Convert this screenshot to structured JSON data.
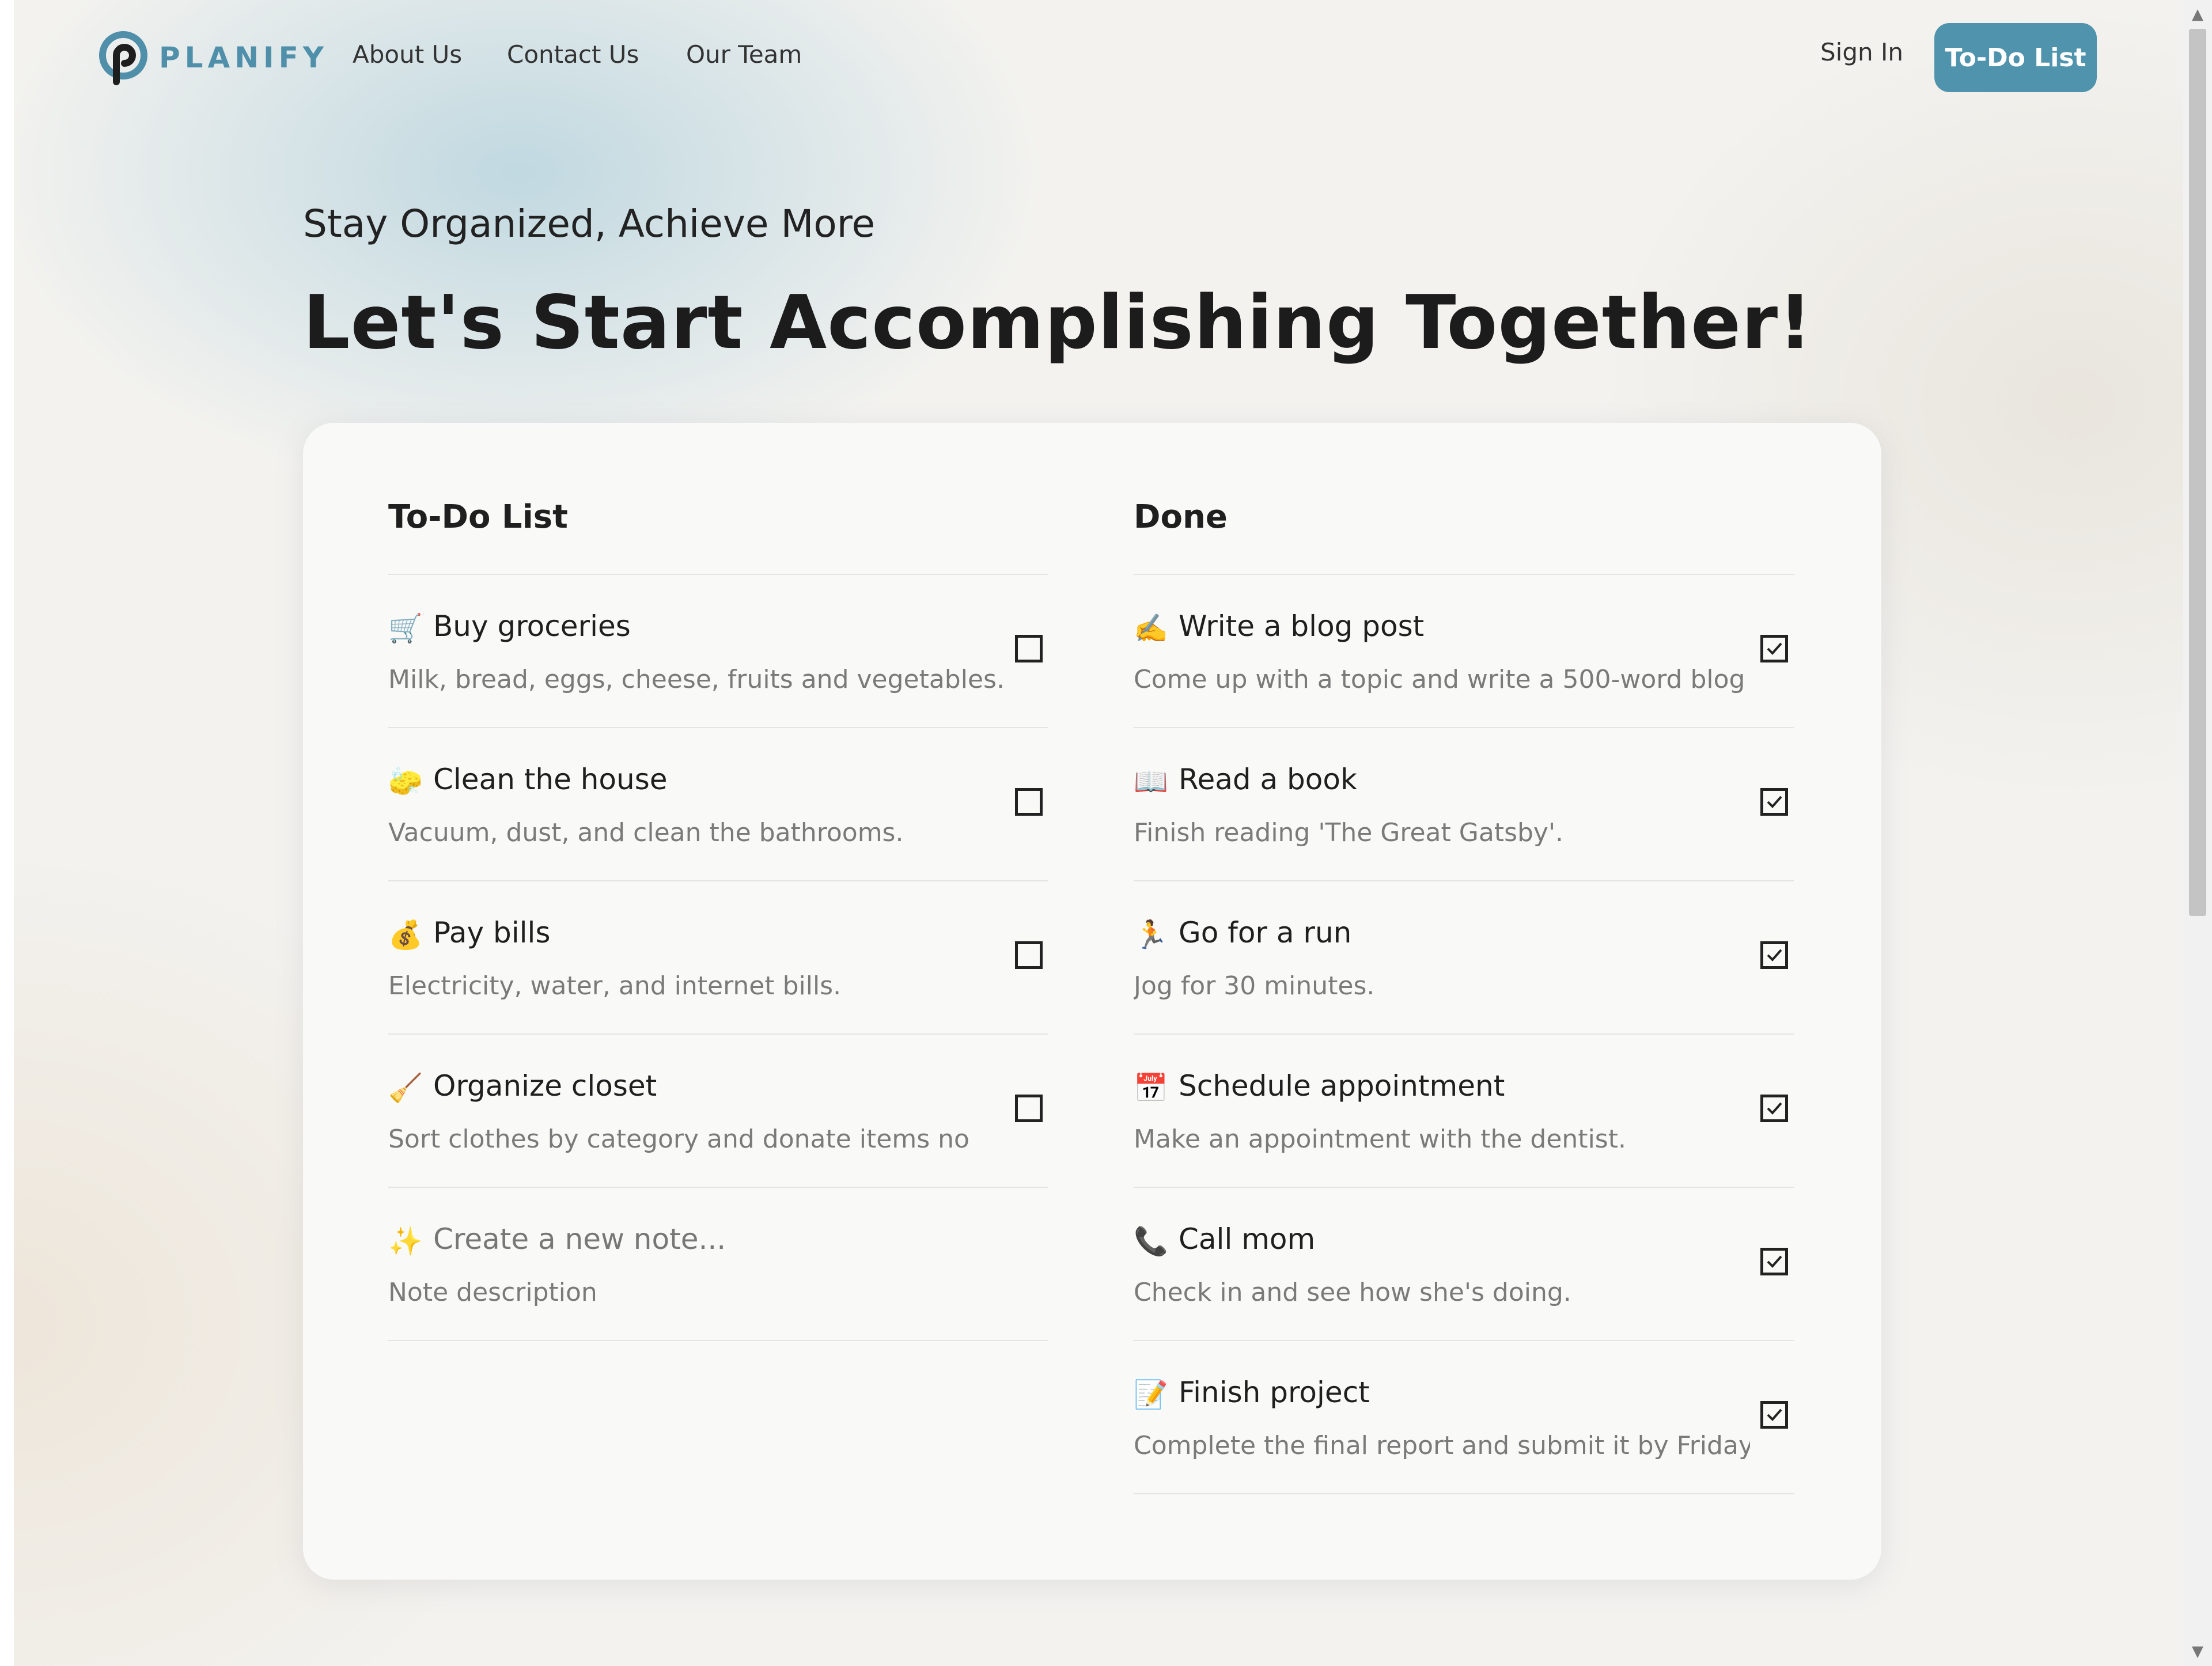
{
  "nav": {
    "brand": "PLANIFY",
    "links": [
      "About Us",
      "Contact Us",
      "Our Team"
    ],
    "sign_in": "Sign In",
    "cta": "To-Do List"
  },
  "hero": {
    "subtitle": "Stay Organized, Achieve More",
    "headline": "Let's Start Accomplishing Together!"
  },
  "todo": {
    "heading": "To-Do List",
    "items": [
      {
        "emoji": "🛒",
        "title": "Buy groceries",
        "desc": "Milk, bread, eggs, cheese, fruits and vegetables.",
        "checked": false
      },
      {
        "emoji": "🧽",
        "title": "Clean the house",
        "desc": "Vacuum, dust, and clean the bathrooms.",
        "checked": false
      },
      {
        "emoji": "💰",
        "title": "Pay bills",
        "desc": "Electricity, water, and internet bills.",
        "checked": false
      },
      {
        "emoji": "🧹",
        "title": "Organize closet",
        "desc": "Sort clothes by category and donate items no",
        "checked": false
      }
    ],
    "new_note": {
      "emoji": "✨",
      "title_placeholder": "Create a new note...",
      "desc_placeholder": "Note description"
    }
  },
  "done": {
    "heading": "Done",
    "items": [
      {
        "emoji": "✍️",
        "title": "Write a blog post",
        "desc": "Come up with a topic and write a 500-word blog",
        "checked": true
      },
      {
        "emoji": "📖",
        "title": "Read a book",
        "desc": "Finish reading 'The Great Gatsby'.",
        "checked": true
      },
      {
        "emoji": "🏃",
        "title": "Go for a run",
        "desc": "Jog for 30 minutes.",
        "checked": true
      },
      {
        "emoji": "📅",
        "title": "Schedule appointment",
        "desc": "Make an appointment with the dentist.",
        "checked": true
      },
      {
        "emoji": "📞",
        "title": "Call mom",
        "desc": "Check in and see how she's doing.",
        "checked": true
      },
      {
        "emoji": "📝",
        "title": "Finish project",
        "desc": "Complete the final report and submit it by Friday.",
        "checked": true
      }
    ]
  },
  "colors": {
    "accent": "#4f93ad",
    "brand_text": "#4f8fa9"
  }
}
